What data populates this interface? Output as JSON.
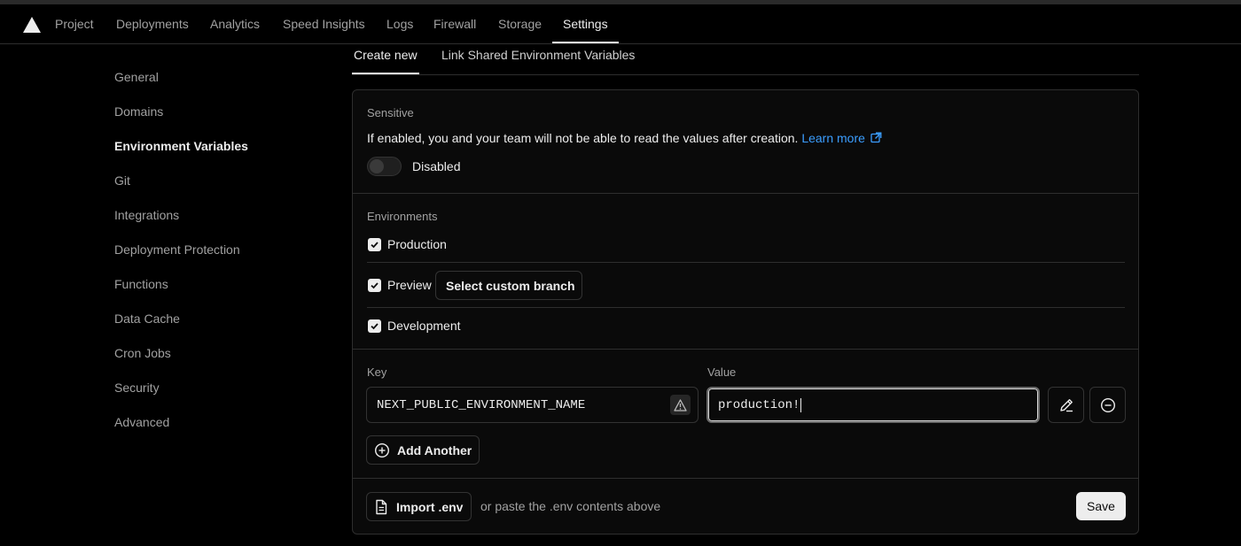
{
  "topnav": {
    "items": [
      {
        "label": "Project"
      },
      {
        "label": "Deployments"
      },
      {
        "label": "Analytics"
      },
      {
        "label": "Speed Insights"
      },
      {
        "label": "Logs"
      },
      {
        "label": "Firewall"
      },
      {
        "label": "Storage"
      },
      {
        "label": "Settings",
        "active": true
      }
    ]
  },
  "sidebar": {
    "items": [
      {
        "label": "General"
      },
      {
        "label": "Domains"
      },
      {
        "label": "Environment Variables",
        "active": true
      },
      {
        "label": "Git"
      },
      {
        "label": "Integrations"
      },
      {
        "label": "Deployment Protection"
      },
      {
        "label": "Functions"
      },
      {
        "label": "Data Cache"
      },
      {
        "label": "Cron Jobs"
      },
      {
        "label": "Security"
      },
      {
        "label": "Advanced"
      }
    ]
  },
  "tabs": {
    "create_new": "Create new",
    "link_shared": "Link Shared Environment Variables"
  },
  "sensitive": {
    "title": "Sensitive",
    "description": "If enabled, you and your team will not be able to read the values after creation.",
    "learn_more": "Learn more",
    "toggle_label": "Disabled",
    "enabled": false
  },
  "environments": {
    "title": "Environments",
    "production": {
      "label": "Production",
      "checked": true
    },
    "preview": {
      "label": "Preview",
      "checked": true,
      "branch_button": "Select custom branch"
    },
    "development": {
      "label": "Development",
      "checked": true
    }
  },
  "variables": {
    "key_label": "Key",
    "value_label": "Value",
    "key_value": "NEXT_PUBLIC_ENVIRONMENT_NAME",
    "value_value": "production!",
    "add_another": "Add Another"
  },
  "footer": {
    "import_button": "Import .env",
    "paste_hint": "or paste the .env contents above",
    "save_button": "Save"
  },
  "colors": {
    "background": "#000000",
    "card": "#0a0a0a",
    "border": "#2e2e2e",
    "link": "#3b9eff",
    "text": "#ededed",
    "muted": "#a1a1a1"
  }
}
